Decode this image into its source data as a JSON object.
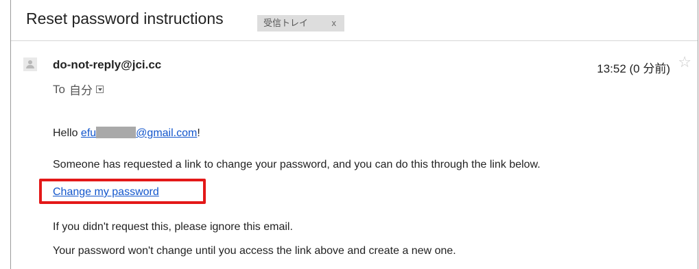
{
  "email": {
    "subject": "Reset password instructions",
    "label": {
      "text": "受信トレイ",
      "remove": "x"
    },
    "sender": "do-not-reply@jci.cc",
    "to": {
      "prefix": "To",
      "recipient": "自分"
    },
    "time": "13:52 (0 分前)",
    "icons": {
      "star": "star-icon",
      "avatar": "avatar-icon",
      "details": "chevron-down-icon"
    },
    "body": {
      "greeting": "Hello",
      "email_prefix": "efu",
      "email_suffix": "@gmail.com",
      "greeting_end": "!",
      "p1": "Someone has requested a link to change your password, and you can do this through the link below.",
      "link_text": "Change my password",
      "p2": "If you didn't request this, please ignore this email.",
      "p3": "Your password won't change until you access the link above and create a new one."
    },
    "colors": {
      "link": "#1155cc",
      "highlight_box": "#e31818",
      "label_bg": "#dddddd"
    }
  }
}
